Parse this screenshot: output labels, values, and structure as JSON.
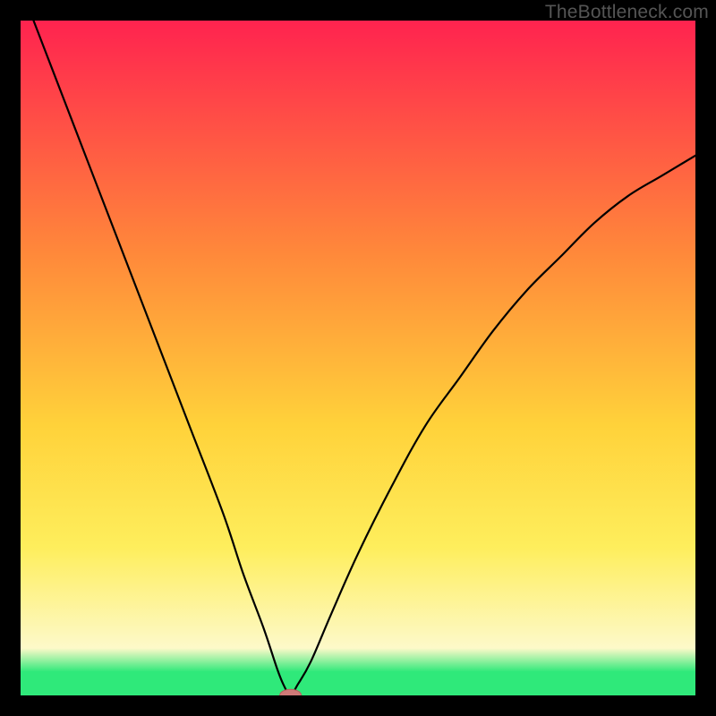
{
  "watermark": "TheBottleneck.com",
  "colors": {
    "frame_bg": "#000000",
    "gradient_top": "#ff234f",
    "gradient_mid_upper": "#ff8a3a",
    "gradient_mid": "#ffd23a",
    "gradient_mid_lower": "#feee5c",
    "gradient_pale": "#fdf9c9",
    "gradient_green": "#2fe97a",
    "curve": "#000000",
    "marker_fill": "#cf7a78",
    "marker_stroke": "#b85f5e"
  },
  "chart_data": {
    "type": "line",
    "title": "",
    "xlabel": "",
    "ylabel": "",
    "xlim": [
      0,
      100
    ],
    "ylim": [
      0,
      100
    ],
    "series": [
      {
        "name": "bottleneck-curve",
        "x": [
          0,
          5,
          10,
          15,
          20,
          25,
          30,
          33,
          36,
          38,
          39,
          40,
          41,
          43,
          46,
          50,
          55,
          60,
          65,
          70,
          75,
          80,
          85,
          90,
          95,
          100
        ],
        "values": [
          105,
          92,
          79,
          66,
          53,
          40,
          27,
          18,
          10,
          4,
          1.5,
          0,
          1.5,
          5,
          12,
          21,
          31,
          40,
          47,
          54,
          60,
          65,
          70,
          74,
          77,
          80
        ]
      }
    ],
    "marker": {
      "x": 40,
      "y": 0,
      "rx": 1.6,
      "ry": 0.9
    },
    "gradient_stops": [
      {
        "offset": 0.0,
        "key": "gradient_top"
      },
      {
        "offset": 0.35,
        "key": "gradient_mid_upper"
      },
      {
        "offset": 0.6,
        "key": "gradient_mid"
      },
      {
        "offset": 0.78,
        "key": "gradient_mid_lower"
      },
      {
        "offset": 0.93,
        "key": "gradient_pale"
      },
      {
        "offset": 0.965,
        "key": "gradient_green"
      },
      {
        "offset": 1.0,
        "key": "gradient_green"
      }
    ]
  }
}
